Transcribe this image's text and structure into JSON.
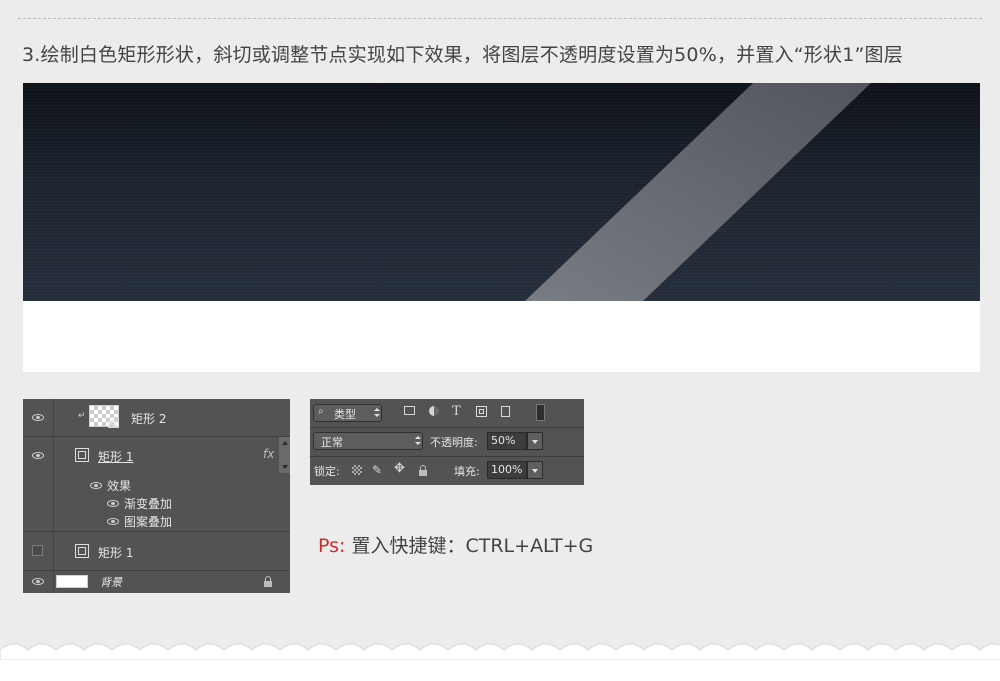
{
  "step_title": "3.绘制白色矩形形状，斜切或调整节点实现如下效果，将图层不透明度设置为50%，并置入“形状1”图层",
  "layers": [
    {
      "name": "矩形 2",
      "visible": true
    },
    {
      "name": "矩形 1",
      "visible": true,
      "fx": "fx"
    },
    {
      "name": "效果",
      "visible": true
    },
    {
      "name": "渐变叠加",
      "visible": true
    },
    {
      "name": "图案叠加",
      "visible": true
    },
    {
      "name": "矩形 1",
      "visible": false
    },
    {
      "name": "背景",
      "visible": true,
      "locked": true
    }
  ],
  "options": {
    "filter_label": "类型",
    "blend_mode": "正常",
    "opacity_label": "不透明度:",
    "opacity_value": "50%",
    "lock_label": "锁定:",
    "fill_label": "填充:",
    "fill_value": "100%",
    "text_tool_glyph": "T"
  },
  "shortcut": {
    "prefix": "Ps:",
    "text": "置入快捷键：CTRL+ALT+G"
  },
  "colors": {
    "accent": "#d62b2b",
    "panel": "#535353",
    "page": "#ececec"
  }
}
